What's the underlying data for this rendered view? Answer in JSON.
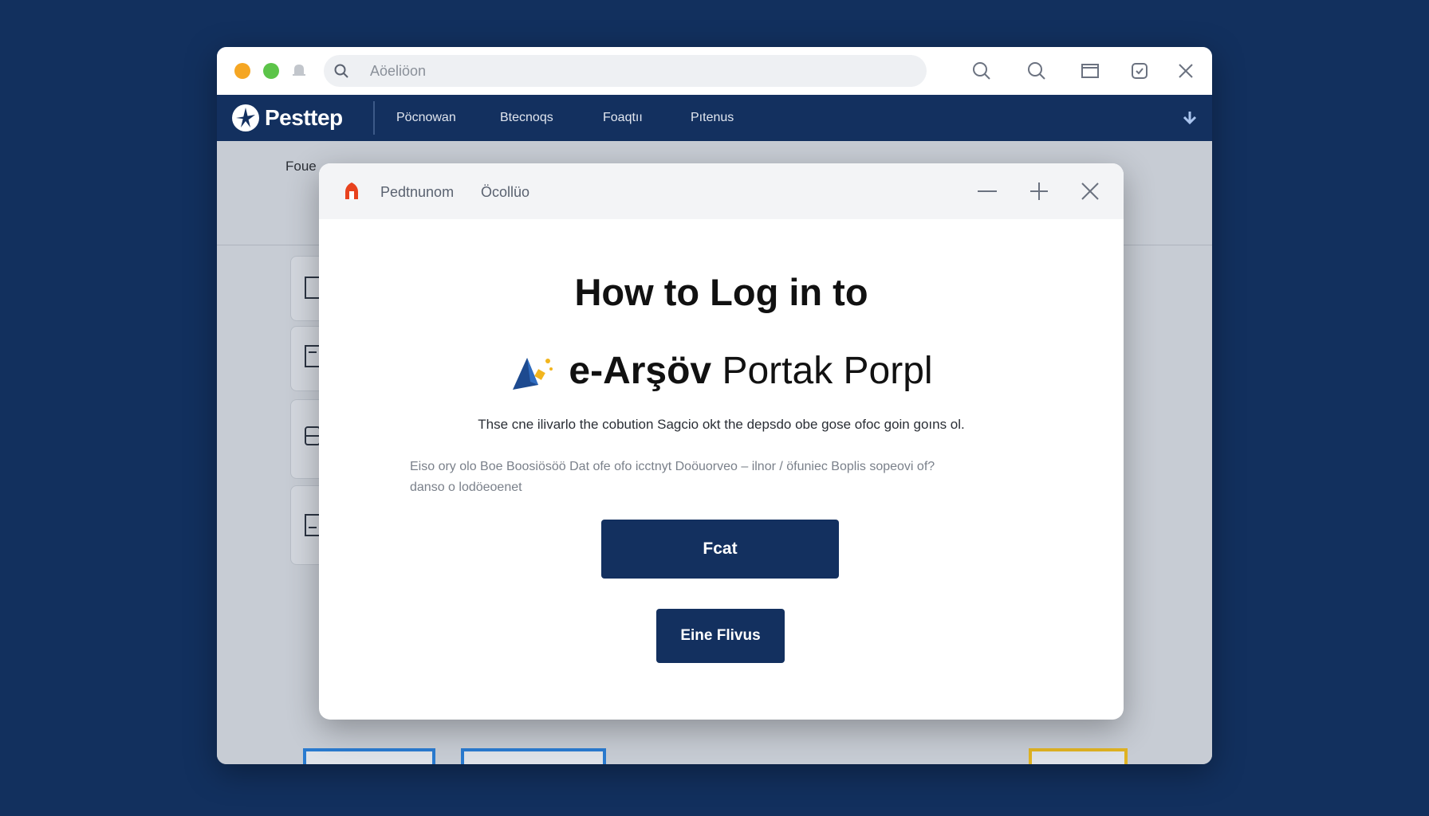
{
  "titlebar": {
    "address_text": "Aöeliöon",
    "icons": [
      "search-icon",
      "search-icon",
      "window-icon",
      "copy-icon",
      "close-icon"
    ]
  },
  "navbar": {
    "brand": "Pesttep",
    "items": [
      "Pöcnowan",
      "Btecnoqs",
      "Foaqtıı",
      "Pıtenus"
    ]
  },
  "background": {
    "crumb": "Foue"
  },
  "dialog": {
    "header_title": "Pedtnunom",
    "header_sub": "Öcollüo",
    "title": "How to Log in to",
    "portal_name_bold": "e-Arşöv",
    "portal_name_rest": "Portak Porpl",
    "lead": "Thse cne ilivarlo the cobution Sagcio okt the depsdo obe gose ofoc goin goıns ol.",
    "desc_line1": "Eiso ory olo Boe Boosiösöö Dat ofe ofo icctnyt Doöuorveo – ilnor / öfuniec Boplis sopeovi of?",
    "desc_line2": "danso o lodöeoenet",
    "primary_button": "Fcat",
    "secondary_button": "Eine Flivus"
  },
  "colors": {
    "page_bg": "#12305e",
    "nav_bg": "#13305f",
    "button_bg": "#13305f",
    "traffic_orange": "#f5a623",
    "traffic_green": "#5cc449",
    "app_icon": "#e8421e"
  }
}
